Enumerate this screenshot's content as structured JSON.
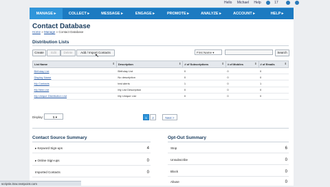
{
  "header": {
    "links": [
      "Hello",
      "Michael",
      "Help"
    ],
    "badge_count": "17"
  },
  "nav": [
    "MANAGE",
    "COLLECT",
    "MESSAGE",
    "ENGAGE",
    "PROMOTE",
    "ANALYZE",
    "ACCOUNT",
    "HELP"
  ],
  "page": {
    "title": "Contact Database",
    "breadcrumb": {
      "home": "Home",
      "manage": "Manage",
      "current": "Contact Database"
    }
  },
  "distribution": {
    "heading": "Distribution Lists",
    "toolbar": {
      "create": "Create",
      "edit": "Edit",
      "delete": "Delete",
      "add_import": "Add / Import Contacts"
    },
    "search": {
      "field": "First Name",
      "button": "Search"
    },
    "columns": [
      "List Name",
      "Description",
      "# of Subscriptions",
      "# of Mobiles",
      "# of Emails"
    ],
    "rows": [
      [
        "Birthday List",
        "Birthday List",
        "0",
        "0",
        "0"
      ],
      [
        "Display Name",
        "No description",
        "0",
        "0",
        "0"
      ],
      [
        "My Contacts",
        "test alerts",
        "1",
        "0",
        "1"
      ],
      [
        "My New List",
        "My List Description",
        "0",
        "0",
        "0"
      ],
      [
        "My Unique Distribution List",
        "My Unique List",
        "0",
        "0",
        "0"
      ]
    ],
    "display_label": "Display:",
    "display_value": "5",
    "pagination": {
      "current": "1",
      "next": "2",
      "next_label": "Next >"
    }
  },
  "contact_source": {
    "heading": "Contact Source Summary",
    "rows": [
      {
        "label": "Keyword Sign-ups",
        "value": "4"
      },
      {
        "label": "Online Sign-ups",
        "value": "0"
      },
      {
        "label": "Imported Contacts",
        "value": "0"
      }
    ]
  },
  "opt_out": {
    "heading": "Opt-Out Summary",
    "rows": [
      {
        "label": "Stop",
        "value": "6"
      },
      {
        "label": "Unsubscribe",
        "value": "0"
      },
      {
        "label": "Block",
        "value": "0"
      },
      {
        "label": "Abuse",
        "value": "0"
      }
    ]
  },
  "status_bar": "scriptin.itrac.textpoint.com",
  "colors": {
    "nav_blue": "#1c7ac1",
    "nav_active": "#2f95da",
    "title": "#1b3d5e",
    "link": "#2a5da8"
  }
}
